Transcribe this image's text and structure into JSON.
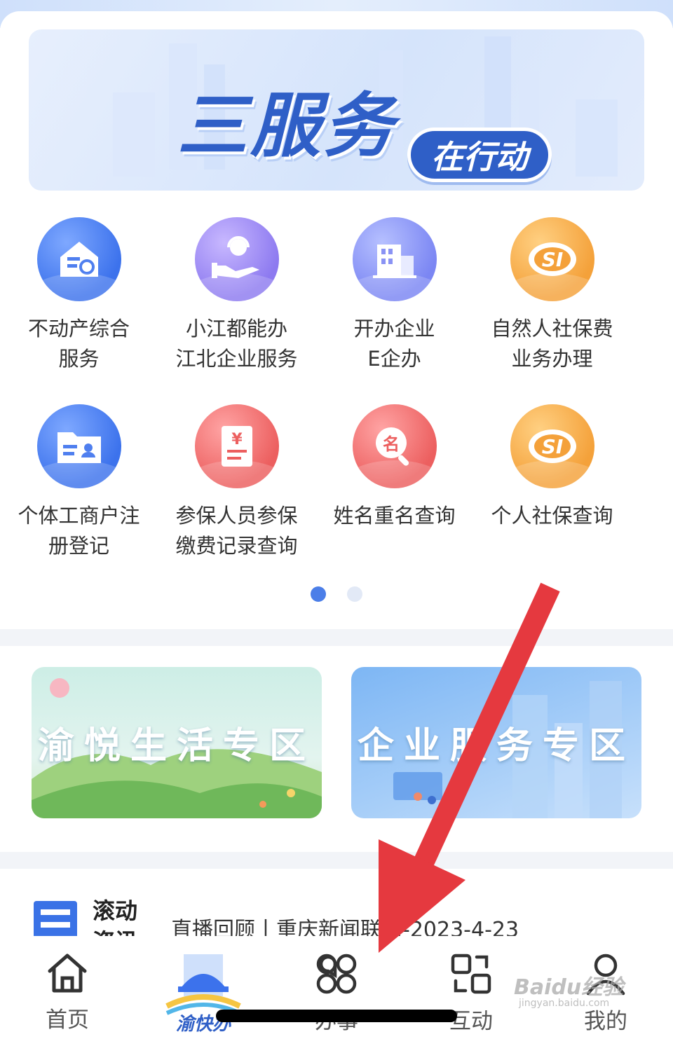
{
  "banner": {
    "title": "三服务",
    "pill": "在行动"
  },
  "services": [
    {
      "line1": "不动产综合",
      "line2": "服务",
      "icon": "house-document-icon",
      "color": "blue"
    },
    {
      "line1": "小江都能办",
      "line2": "江北企业服务",
      "icon": "service-hand-icon",
      "color": "purple"
    },
    {
      "line1": "开办企业",
      "line2": "E企办",
      "icon": "building-icon",
      "color": "indigo"
    },
    {
      "line1": "自然人社保费",
      "line2": "业务办理",
      "icon": "social-security-logo-icon",
      "color": "orange"
    },
    {
      "line1": "个体工商户注",
      "line2": "册登记",
      "icon": "id-card-folder-icon",
      "color": "blue"
    },
    {
      "line1": "参保人员参保",
      "line2": "缴费记录查询",
      "icon": "yuan-receipt-icon",
      "color": "red"
    },
    {
      "line1": "姓名重名查询",
      "line2": "",
      "icon": "name-search-icon",
      "color": "red"
    },
    {
      "line1": "个人社保查询",
      "line2": "",
      "icon": "social-security-logo-icon",
      "color": "orange"
    }
  ],
  "pager": {
    "pages": 2,
    "active": 1
  },
  "zones": {
    "life": "渝悦生活专区",
    "business": "企业服务专区"
  },
  "news": {
    "tag": "滚动资讯",
    "headline": "直播回顾丨重庆新闻联播-2023-4-23"
  },
  "tabs": [
    {
      "label": "首页",
      "icon": "home-icon"
    },
    {
      "label": "渝快办",
      "icon": "yukuaiban-logo-icon"
    },
    {
      "label": "办事",
      "icon": "four-petal-grid-icon"
    },
    {
      "label": "互动",
      "icon": "interaction-swap-icon"
    },
    {
      "label": "我的",
      "icon": "user-icon"
    }
  ],
  "watermark": {
    "text": "Baidu经验",
    "sub": "jingyan.baidu.com"
  },
  "colors": {
    "accent": "#3c72ec",
    "annotation_arrow": "#e5393f"
  }
}
